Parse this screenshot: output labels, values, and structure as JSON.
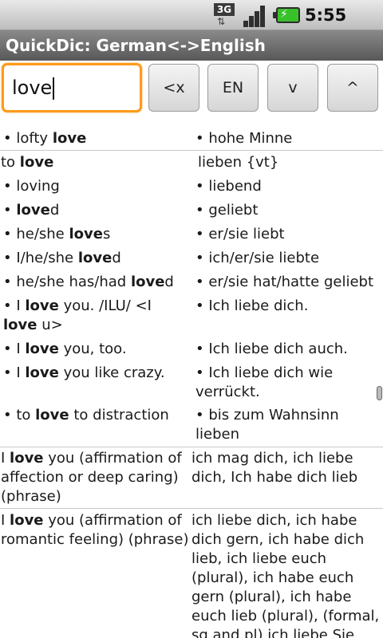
{
  "status": {
    "network": "3G",
    "time": "5:55 PM"
  },
  "app": {
    "title": "QuickDic: German<->English"
  },
  "search": {
    "value": "love"
  },
  "buttons": {
    "clear": "<x",
    "lang": "EN",
    "down": "v",
    "up": "^"
  },
  "results": {
    "r1_left": "• lofty love",
    "r1_right": "• hohe Minne",
    "r2_left": "to love",
    "r2_right": "lieben {vt}",
    "r3_left": "• loving",
    "r3_right": "• liebend",
    "r4_left": "• loved",
    "r4_right": "• geliebt",
    "r5_left": "• he/she loves",
    "r5_right": "• er/sie liebt",
    "r6_left": "• I/he/she loved",
    "r6_right": "• ich/er/sie liebte",
    "r7_left": "• he/she has/had loved",
    "r7_right": "• er/sie hat/hatte geliebt",
    "r8_left": "• I love you. /ILU/ <I love u>",
    "r8_right": "• Ich liebe dich.",
    "r9_left": "• I love you, too.",
    "r9_right": "• Ich liebe dich auch.",
    "r10_left": "• I love you like crazy.",
    "r10_right": "• Ich liebe dich wie verrückt.",
    "r11_left": "• to love to distraction",
    "r11_right": "• bis zum Wahnsinn lieben",
    "r12_left": "I love you (affirmation of affection or deep caring) (phrase)",
    "r12_right": "ich mag dich, ich liebe dich, Ich habe dich lieb",
    "r13_left": "I love you (affirmation of romantic feeling) (phrase)",
    "r13_right": "ich liebe dich, ich habe dich gern, ich habe dich lieb, ich liebe euch (plural), ich habe euch gern (plural), ich habe euch lieb (plural), (formal, sg and pl) ich liebe Sie"
  }
}
